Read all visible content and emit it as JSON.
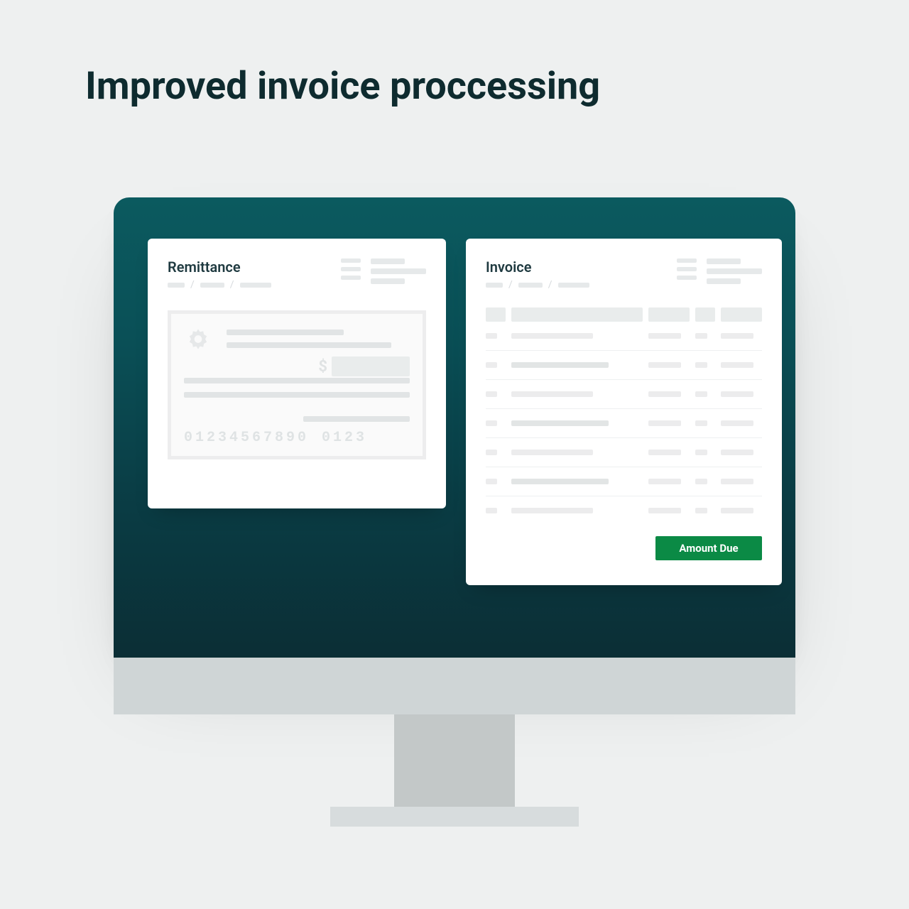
{
  "page": {
    "title": "Improved invoice proccessing"
  },
  "cards": {
    "remittance": {
      "title": "Remittance",
      "check": {
        "dollar_sign": "$",
        "micr_account": "01234567890",
        "micr_routing": "0123"
      }
    },
    "invoice": {
      "title": "Invoice",
      "amount_due_label": "Amount Due"
    }
  }
}
